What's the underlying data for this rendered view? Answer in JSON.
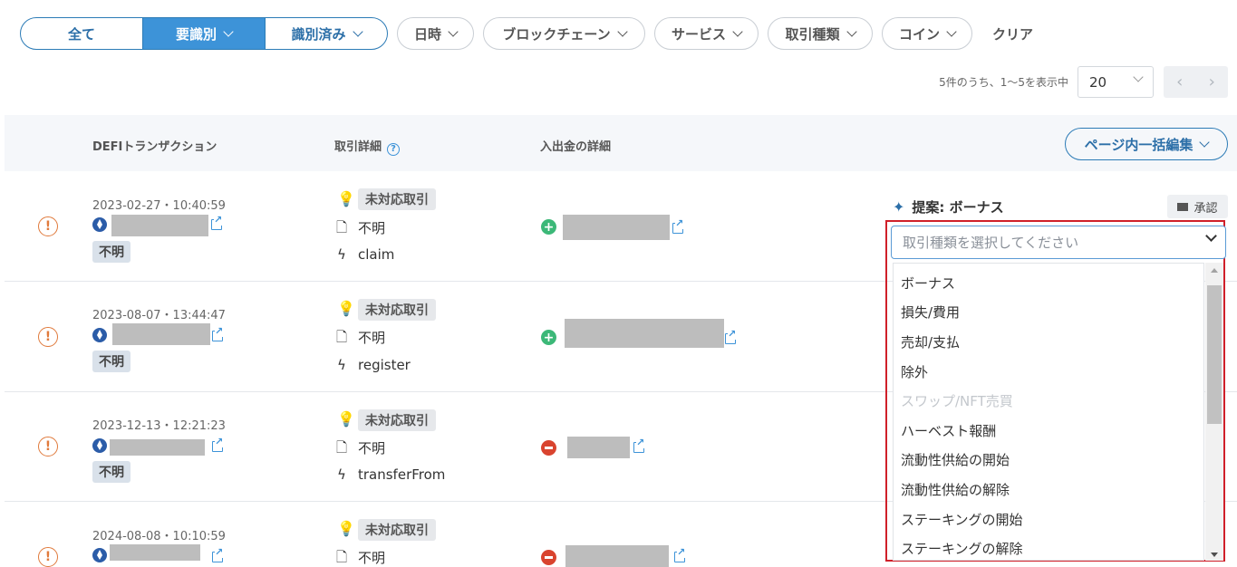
{
  "filters": {
    "segments": [
      {
        "label": "全て",
        "active": false
      },
      {
        "label": "要識別",
        "active": true
      },
      {
        "label": "識別済み",
        "active": false
      }
    ],
    "dropdowns": [
      "日時",
      "ブロックチェーン",
      "サービス",
      "取引種類",
      "コイン"
    ],
    "clear_label": "クリア"
  },
  "pagination": {
    "summary": "5件のうち、1〜5を表示中",
    "per_page": "20",
    "prev_icon": "‹",
    "next_icon": "›"
  },
  "table": {
    "headers": {
      "defi": "DEFIトランザクション",
      "detail": "取引詳細",
      "transfer": "入出金の詳細"
    },
    "bulk_edit_label": "ページ内一括編集",
    "rows": [
      {
        "datetime": "2023-02-27・10:40:59",
        "status_tag": "不明",
        "type_tag": "未対応取引",
        "category": "不明",
        "method": "claim",
        "direction": "in"
      },
      {
        "datetime": "2023-08-07・13:44:47",
        "status_tag": "不明",
        "type_tag": "未対応取引",
        "category": "不明",
        "method": "register",
        "direction": "in"
      },
      {
        "datetime": "2023-12-13・12:21:23",
        "status_tag": "不明",
        "type_tag": "未対応取引",
        "category": "不明",
        "method": "transferFrom",
        "direction": "out"
      },
      {
        "datetime": "2024-08-08・10:10:59",
        "status_tag": "",
        "type_tag": "未対応取引",
        "category": "不明",
        "method": "",
        "direction": "out"
      }
    ]
  },
  "suggestion": {
    "label": "提案: ボーナス",
    "approve_label": "承認"
  },
  "type_select": {
    "placeholder": "取引種類を選択してください",
    "options": [
      {
        "label": "ボーナス",
        "disabled": false
      },
      {
        "label": "損失/費用",
        "disabled": false
      },
      {
        "label": "売却/支払",
        "disabled": false
      },
      {
        "label": "除外",
        "disabled": false
      },
      {
        "label": "スワップ/NFT売買",
        "disabled": true
      },
      {
        "label": "ハーベスト報酬",
        "disabled": false
      },
      {
        "label": "流動性供給の開始",
        "disabled": false
      },
      {
        "label": "流動性供給の解除",
        "disabled": false
      },
      {
        "label": "ステーキングの開始",
        "disabled": false
      },
      {
        "label": "ステーキングの解除",
        "disabled": false
      }
    ]
  },
  "icons": {
    "warning": "!",
    "plus": "+",
    "wand": "magic-wand-icon"
  },
  "colors": {
    "accent": "#3d93d8",
    "warning": "#e07a3c",
    "incoming": "#3cb878",
    "outgoing": "#d9442f",
    "highlight": "#d0202a"
  }
}
